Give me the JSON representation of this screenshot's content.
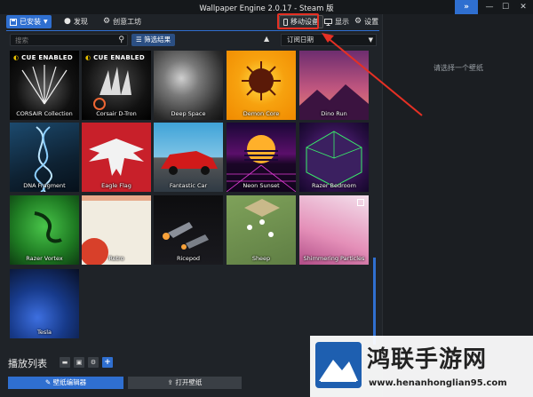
{
  "titlebar": {
    "title": "Wallpaper Engine 2.0.17 - Steam 版",
    "expand_icon": "»",
    "minimize_icon": "—",
    "maximize_icon": "☐",
    "close_icon": "✕"
  },
  "toolbar": {
    "installed": "已安装",
    "discover": "发现",
    "workshop": "创意工坊",
    "mobile": "移动设备",
    "display": "显示",
    "settings": "设置"
  },
  "filters": {
    "search_placeholder": "搜索",
    "filter_button": "筛选结果",
    "sort_value": "订阅日期"
  },
  "wallpapers": [
    {
      "title": "CORSAIR Collection",
      "badge": "CUE ENABLED"
    },
    {
      "title": "Corsair D-Tron",
      "badge": "CUE ENABLED"
    },
    {
      "title": "Deep Space",
      "badge": ""
    },
    {
      "title": "Demon Core",
      "badge": ""
    },
    {
      "title": "Dino Run",
      "badge": ""
    },
    {
      "title": "DNA Fragment",
      "badge": ""
    },
    {
      "title": "Eagle Flag",
      "badge": ""
    },
    {
      "title": "Fantastic Car",
      "badge": ""
    },
    {
      "title": "Neon Sunset",
      "badge": ""
    },
    {
      "title": "Razer Bedroom",
      "badge": ""
    },
    {
      "title": "Razer Vortex",
      "badge": ""
    },
    {
      "title": "Retro",
      "badge": ""
    },
    {
      "title": "Ricepod",
      "badge": ""
    },
    {
      "title": "Sheep",
      "badge": ""
    },
    {
      "title": "Shimmering Particles",
      "badge": ""
    },
    {
      "title": "Tesla",
      "badge": ""
    }
  ],
  "right_pane": {
    "hint": "请选择一个壁纸"
  },
  "playlist": {
    "title": "播放列表",
    "editor_button": "壁纸编辑器",
    "open_button": "打开壁纸"
  },
  "watermark": {
    "name": "鸿联手游网",
    "url": "www.henanhonglian95.com"
  },
  "colors": {
    "accent": "#2f6fd0",
    "annotation": "#e53024"
  }
}
